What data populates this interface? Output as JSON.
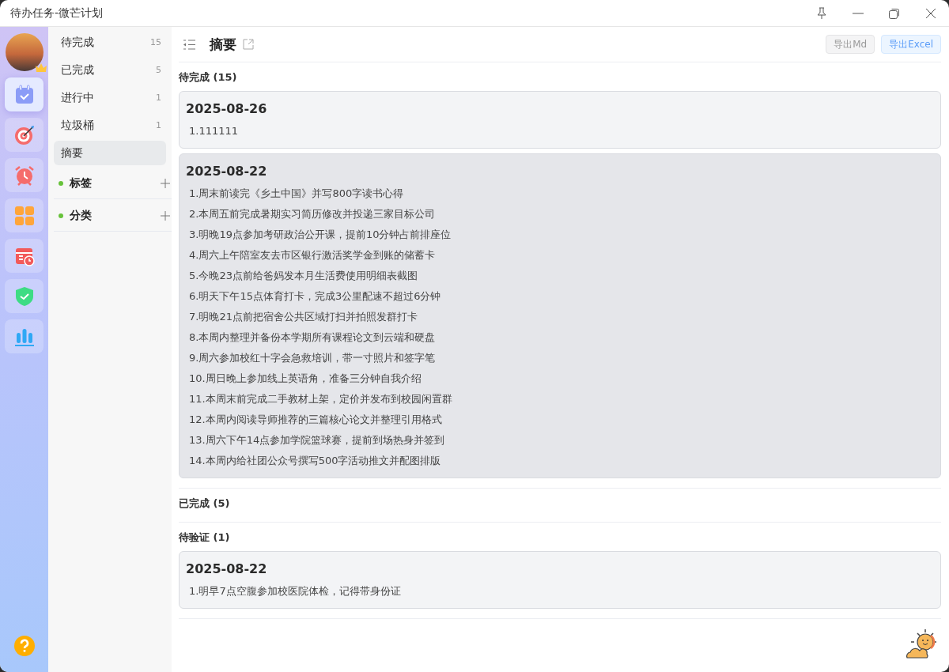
{
  "window": {
    "title": "待办任务-微芒计划"
  },
  "rail": {
    "items": [
      {
        "kind": "calendar-check",
        "selected": true
      },
      {
        "kind": "target",
        "selected": false
      },
      {
        "kind": "alarm",
        "selected": false
      },
      {
        "kind": "grid",
        "selected": false
      },
      {
        "kind": "schedule",
        "selected": false
      },
      {
        "kind": "shield",
        "selected": false
      },
      {
        "kind": "chart",
        "selected": false
      }
    ]
  },
  "nav": {
    "items": [
      {
        "label": "待完成",
        "count": "15",
        "selected": false
      },
      {
        "label": "已完成",
        "count": "5",
        "selected": false
      },
      {
        "label": "进行中",
        "count": "1",
        "selected": false
      },
      {
        "label": "垃圾桶",
        "count": "1",
        "selected": false
      },
      {
        "label": "摘要",
        "selected": true
      }
    ],
    "sections": [
      {
        "label": "标签",
        "color": "#67c23a"
      },
      {
        "label": "分类",
        "color": "#67c23a"
      }
    ]
  },
  "header": {
    "title": "摘要",
    "buttons": [
      {
        "label": "导出Md",
        "kind": "plain"
      },
      {
        "label": "导出Excel",
        "kind": "primary"
      }
    ]
  },
  "groups": [
    {
      "title": "待完成 (15)",
      "cards": [
        {
          "date": "2025-08-26",
          "highlighted": false,
          "items": [
            "1.111111"
          ]
        },
        {
          "date": "2025-08-22",
          "highlighted": true,
          "items": [
            "1.周末前读完《乡土中国》并写800字读书心得",
            "2.本周五前完成暑期实习简历修改并投递三家目标公司",
            "3.明晚19点参加考研政治公开课，提前10分钟占前排座位",
            "4.周六上午陪室友去市区银行激活奖学金到账的储蓄卡",
            "5.今晚23点前给爸妈发本月生活费使用明细表截图",
            "6.明天下午15点体育打卡，完成3公里配速不超过6分钟",
            "7.明晚21点前把宿舍公共区域打扫并拍照发群打卡",
            "8.本周内整理并备份本学期所有课程论文到云端和硬盘",
            "9.周六参加校红十字会急救培训，带一寸照片和签字笔",
            "10.周日晚上参加线上英语角，准备三分钟自我介绍",
            "11.本周末前完成二手教材上架，定价并发布到校园闲置群",
            "12.本周内阅读导师推荐的三篇核心论文并整理引用格式",
            "13.周六下午14点参加学院篮球赛，提前到场热身并签到",
            "14.本周内给社团公众号撰写500字活动推文并配图排版"
          ]
        }
      ]
    },
    {
      "title": "已完成 (5)"
    },
    {
      "title": "待验证 (1)",
      "cards": [
        {
          "date": "2025-08-22",
          "highlighted": false,
          "items": [
            "1.明早7点空腹参加校医院体检，记得带身份证"
          ]
        }
      ]
    }
  ]
}
